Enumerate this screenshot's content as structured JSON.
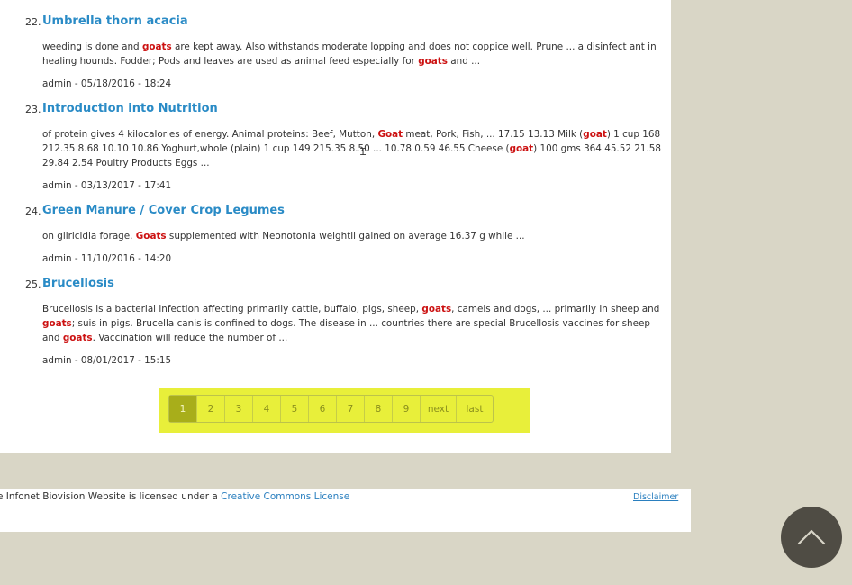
{
  "results": [
    {
      "number": "22.",
      "title": "Umbrella thorn acacia",
      "snippet": [
        {
          "t": "weeding is done and "
        },
        {
          "t": "goats",
          "hl": true
        },
        {
          "t": " are kept away. Also withstands moderate lopping and does not coppice well. Prune ... a disinfect ant in healing hounds. Fodder; Pods and leaves are used as animal feed especially for "
        },
        {
          "t": "goats",
          "hl": true
        },
        {
          "t": " and ..."
        }
      ],
      "meta": "admin - 05/18/2016 - 18:24"
    },
    {
      "number": "23.",
      "title": "Introduction into Nutrition",
      "snippet": [
        {
          "t": "of protein gives 4 kilocalories of energy.   Animal proteins:  Beef, Mutton, "
        },
        {
          "t": "Goat",
          "hl": true
        },
        {
          "t": " meat, Pork, Fish, ... 17.15 13.13 Milk ("
        },
        {
          "t": "goat",
          "hl": true
        },
        {
          "t": ") 1 cup 168 212.35 8.68 10.10 10.86 Yoghurt,whole (plain) 1 cup 149 215.35 8.50 ... 10.78 0.59 46.55 Cheese ("
        },
        {
          "t": "goat",
          "hl": true
        },
        {
          "t": ") 100 gms 364 45.52 21.58 29.84 2.54 Poultry Products            Eggs ..."
        }
      ],
      "meta": "admin - 03/13/2017 - 17:41"
    },
    {
      "number": "24.",
      "title": "Green Manure / Cover Crop Legumes",
      "snippet": [
        {
          "t": "on gliricidia forage.   "
        },
        {
          "t": "Goats",
          "hl": true
        },
        {
          "t": " supplemented with  Neonotonia weightii  gained on average 16.37 g while ..."
        }
      ],
      "meta": "admin - 11/10/2016 - 14:20"
    },
    {
      "number": "25.",
      "title": "Brucellosis",
      "snippet": [
        {
          "t": "Brucellosis is a bacterial infection affecting primarily cattle, buffalo, pigs, sheep, "
        },
        {
          "t": "goats",
          "hl": true
        },
        {
          "t": ", camels and dogs, ... primarily in sheep and "
        },
        {
          "t": "goats",
          "hl": true
        },
        {
          "t": "; suis  in pigs.  Brucella canis  is confined to dogs.    The disease in ... countries there are special Brucellosis vaccines for sheep and "
        },
        {
          "t": "goats",
          "hl": true
        },
        {
          "t": ". Vaccination will reduce the number of ..."
        }
      ],
      "meta": "admin - 08/01/2017 - 15:15"
    }
  ],
  "pager": {
    "pages": [
      "1",
      "2",
      "3",
      "4",
      "5",
      "6",
      "7",
      "8",
      "9"
    ],
    "current": "1",
    "next_label": "next",
    "last_label": "last"
  },
  "footer": {
    "license_text": "e Infonet Biovision Website is licensed under a ",
    "license_link": "Creative Commons License",
    "disclaimer": "Disclaimer"
  },
  "scroll_top": {
    "icon": "chevron-up-icon"
  },
  "colors": {
    "link": "#2a8bc6",
    "highlight": "#cc1111",
    "pager_bg": "#e8ef3a",
    "pager_active": "#a8ae1a",
    "page_bg": "#d9d6c6"
  }
}
